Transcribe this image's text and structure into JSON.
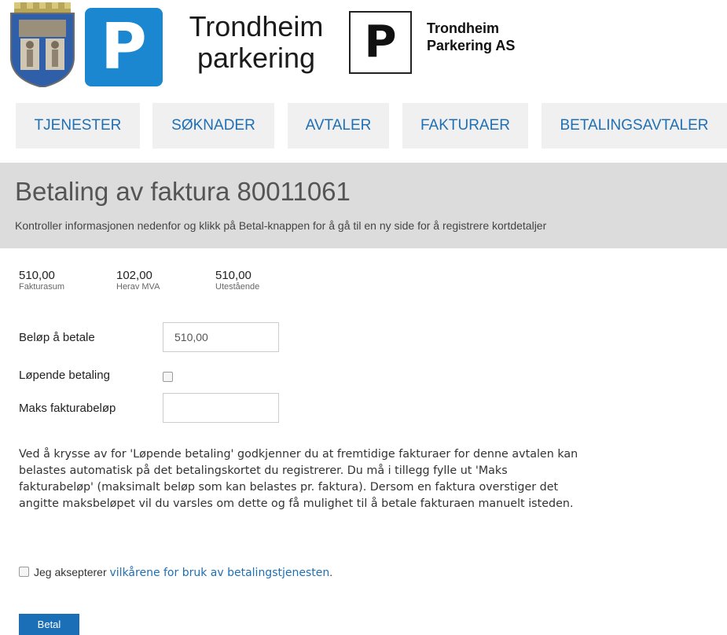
{
  "header": {
    "brand_main_line1": "Trondheim",
    "brand_main_line2": "parkering",
    "brand_secondary_line1": "Trondheim",
    "brand_secondary_line2": "Parkering AS",
    "p_letter": "P",
    "accent_color": "#1a87d0"
  },
  "nav": {
    "items": [
      {
        "label": "TJENESTER"
      },
      {
        "label": "SØKNADER"
      },
      {
        "label": "AVTALER"
      },
      {
        "label": "FAKTURAER"
      },
      {
        "label": "BETALINGSAVTALER"
      }
    ]
  },
  "page": {
    "title": "Betaling av faktura 80011061",
    "subtitle": "Kontroller informasjonen nedenfor og klikk på Betal-knappen for å gå til en ny side for å registrere kortdetaljer"
  },
  "summary": [
    {
      "value": "510,00",
      "label": "Fakturasum"
    },
    {
      "value": "102,00",
      "label": "Herav MVA"
    },
    {
      "value": "510,00",
      "label": "Utestående"
    }
  ],
  "form": {
    "amount_label": "Beløp å betale",
    "amount_value": "510,00",
    "recurring_label": "Løpende betaling",
    "recurring_checked": false,
    "max_label": "Maks fakturabeløp",
    "max_value": ""
  },
  "info_text": "Ved å krysse av for 'Løpende betaling' godkjenner du at fremtidige fakturaer for denne avtalen kan belastes automatisk på det betalingskortet du registrerer. Du må i tillegg fylle ut 'Maks fakturabeløp' (maksimalt beløp som kan belastes pr. faktura). Dersom en faktura overstiger det angitte maksbeløpet vil du varsles om dette og få mulighet til å betale fakturaen manuelt isteden.",
  "accept": {
    "prefix": "Jeg aksepterer",
    "link": "vilkårene for bruk av betalingstjenesten",
    "suffix": "."
  },
  "pay_button": "Betal"
}
